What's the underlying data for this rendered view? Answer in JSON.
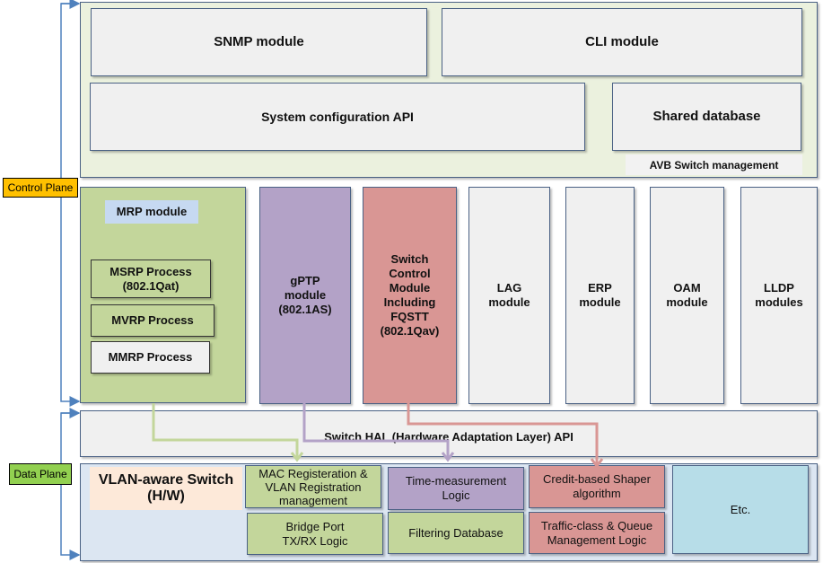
{
  "control_plane": {
    "label": "Control Plane",
    "color": "#FFC000",
    "management": {
      "label": "AVB Switch  management",
      "snmp": "SNMP module",
      "cli": "CLI module",
      "sysconf": "System configuration API",
      "shared_db": "Shared database"
    },
    "mrp": {
      "title": "MRP module",
      "msrp": "MSRP Process\n(802.1Qat)",
      "mvrp": "MVRP Process",
      "mmrp": "MMRP Process"
    },
    "gptp": "gPTP\nmodule\n(802.1AS)",
    "switch_control": "Switch\nControl\nModule\nIncluding\nFQSTT\n(802.1Qav)",
    "lag": "LAG\nmodule",
    "erp": "ERP\nmodule",
    "oam": "OAM\nmodule",
    "lldp": "LLDP\nmodules"
  },
  "hal": "Switch  HAL  (Hardware  Adaptation  Layer)  API",
  "data_plane": {
    "label": "Data Plane",
    "color": "#92D050",
    "vlan_switch": "VLAN-aware Switch\n(H/W)",
    "mac_reg": "MAC Registeration &\nVLAN Registration\nmanagement",
    "bridge_port": "Bridge Port\nTX/RX Logic",
    "time_meas": "Time-measurement\nLogic",
    "filtering_db": "Filtering Database",
    "cbs": "Credit-based Shaper\nalgorithm",
    "traffic_class": "Traffic-class  &  Queue\nManagement  Logic",
    "etc": "Etc."
  }
}
